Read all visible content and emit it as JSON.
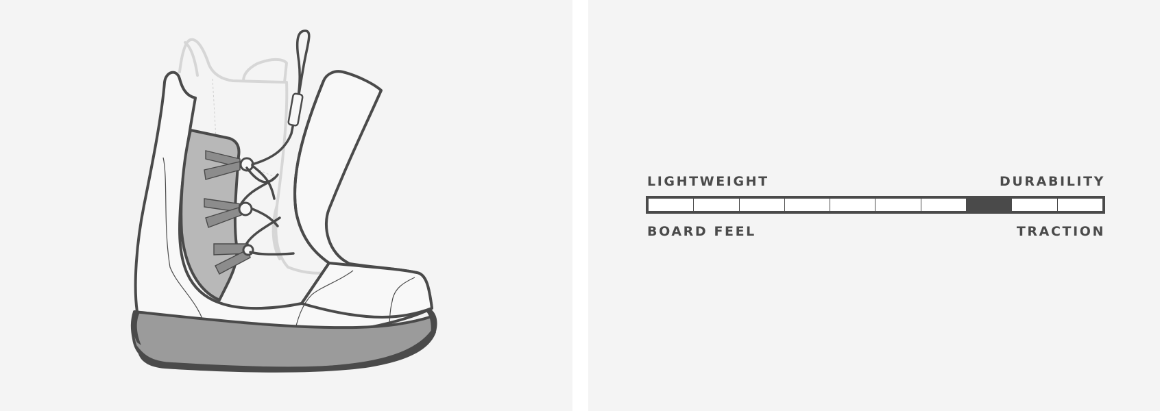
{
  "scale": {
    "left_top_label": "LIGHTWEIGHT",
    "right_top_label": "DURABILITY",
    "left_bottom_label": "BOARD FEEL",
    "right_bottom_label": "TRACTION",
    "segments": 10,
    "selected_segment": 8
  },
  "colors": {
    "panel_bg": "#f4f4f4",
    "outline": "#4a4a4a",
    "liner": "#d6d6d6",
    "panel_fill": "#b8b8b8",
    "lace_tab": "#8c8c8c",
    "sole": "#9b9b9b"
  },
  "icons": {
    "illustration": "snowboard-boot"
  }
}
